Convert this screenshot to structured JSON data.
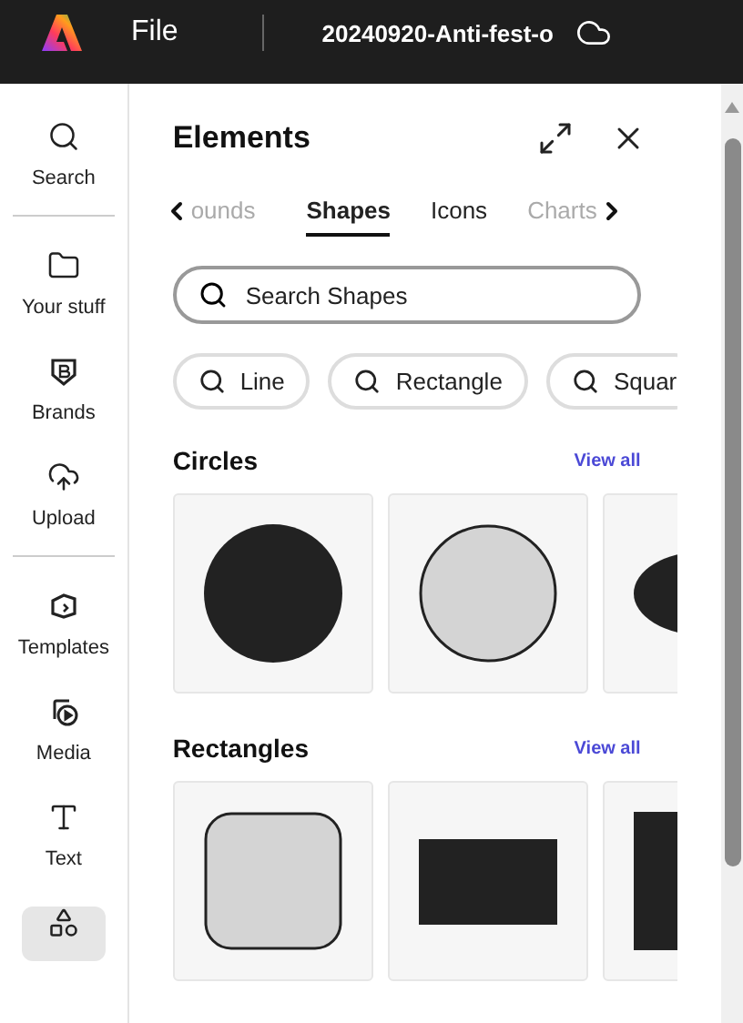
{
  "topbar": {
    "menu": "File",
    "document_title": "20240920-Anti-fest-o"
  },
  "sidebar": {
    "groups": [
      [
        {
          "label": "Search",
          "selected": false
        }
      ],
      [
        {
          "label": "Your stuff",
          "selected": false
        },
        {
          "label": "Brands",
          "selected": false
        },
        {
          "label": "Upload",
          "selected": false
        }
      ],
      [
        {
          "label": "Templates",
          "selected": false
        },
        {
          "label": "Media",
          "selected": false
        },
        {
          "label": "Text",
          "selected": false
        },
        {
          "selected": true
        }
      ]
    ]
  },
  "panel": {
    "title": "Elements",
    "tabs": [
      {
        "label": "ounds",
        "selected": false,
        "faded": true
      },
      {
        "label": "Shapes",
        "selected": true,
        "faded": false
      },
      {
        "label": "Icons",
        "selected": false,
        "faded": false
      },
      {
        "label": "Charts",
        "selected": false,
        "faded": true
      }
    ],
    "search": {
      "placeholder": "Search Shapes"
    },
    "chips": [
      "Line",
      "Rectangle",
      "Squar"
    ],
    "sections": [
      {
        "title": "Circles",
        "link": "View all",
        "tiles": [
          {
            "kind": "circle-filled"
          },
          {
            "kind": "circle-outline"
          },
          {
            "kind": "ellipse-filled"
          }
        ]
      },
      {
        "title": "Rectangles",
        "link": "View all",
        "tiles": [
          {
            "kind": "rounded-square-outline"
          },
          {
            "kind": "rect-filled"
          },
          {
            "kind": "tall-rect-filled"
          }
        ]
      }
    ]
  }
}
